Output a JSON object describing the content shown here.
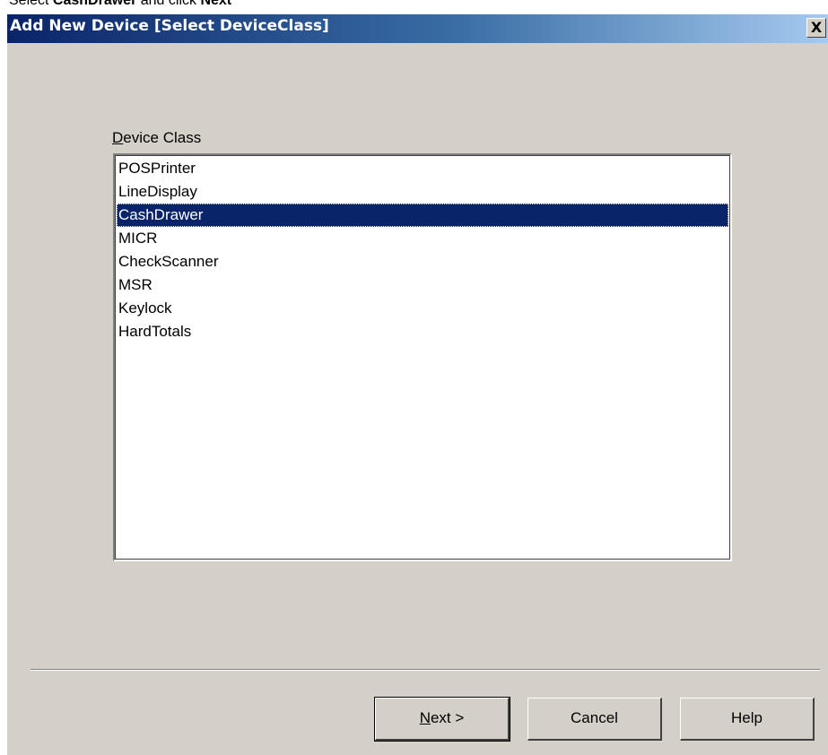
{
  "instruction": {
    "prefix": "Select ",
    "device": "CashDrawer",
    "middle": " and click ",
    "action": "Next"
  },
  "dialog": {
    "title": "Add New Device  [Select DeviceClass]",
    "close_label": "X"
  },
  "device_class": {
    "label": "Device Class",
    "items": [
      "POSPrinter",
      "LineDisplay",
      "CashDrawer",
      "MICR",
      "CheckScanner",
      "MSR",
      "Keylock",
      "HardTotals"
    ],
    "selected": "CashDrawer"
  },
  "buttons": {
    "next": "Next >",
    "cancel": "Cancel",
    "help": "Help"
  },
  "colors": {
    "dialog_bg": "#d4d0c8",
    "title_gradient_start": "#0a246a",
    "title_gradient_end": "#a6caf0",
    "selection_bg": "#0a246a"
  }
}
